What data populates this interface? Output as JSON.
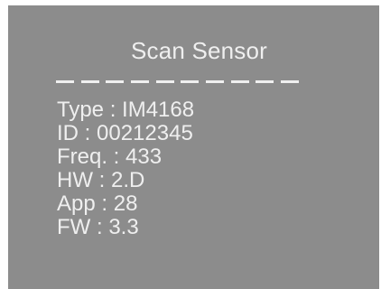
{
  "screen": {
    "title": "Scan Sensor",
    "fields": [
      {
        "label": "Type",
        "value": "IM4168"
      },
      {
        "label": "ID",
        "value": "00212345"
      },
      {
        "label": "Freq.",
        "value": "433"
      },
      {
        "label": "HW",
        "value": "2.D"
      },
      {
        "label": "App",
        "value": "28"
      },
      {
        "label": "FW",
        "value": "3.3"
      }
    ],
    "separator": " : "
  },
  "colors": {
    "background": "#8c8c8c",
    "text": "#efefef"
  }
}
